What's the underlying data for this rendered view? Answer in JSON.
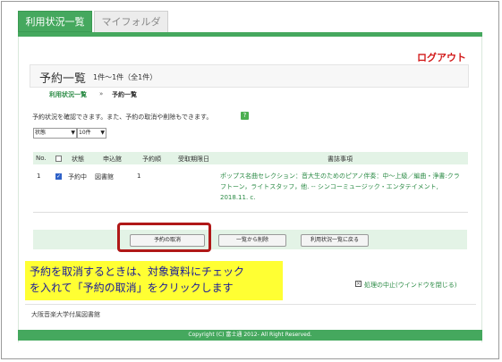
{
  "tabs": {
    "active": "利用状況一覧",
    "inactive": "マイフォルダ"
  },
  "logout": "ログアウト",
  "header": {
    "title": "予約一覧",
    "count": "1件～1件（全1件）"
  },
  "breadcrumb": {
    "link": "利用状況一覧",
    "separator": "»",
    "current": "予約一覧"
  },
  "description": "予約状況を確認できます。また、予約の取消や削除もできます。",
  "help_icon_label": "?",
  "selects": {
    "status": "状態",
    "per_page": "10件"
  },
  "table": {
    "headers": {
      "no": "No.",
      "status": "状態",
      "library": "申込館",
      "order": "予約順",
      "deadline": "受取期限日",
      "item": "書誌事項"
    },
    "rows": [
      {
        "no": "1",
        "checked": true,
        "status": "予約中",
        "library": "図書館",
        "order": "1",
        "deadline": "",
        "item": "ポップス名曲セレクション：音大生のためのピアノ伴奏：中～上級／編曲・浄書:クラフトーン，ライトスタッフ，他. -- シンコーミュージック・エンタテイメント, 2018.11. c."
      }
    ]
  },
  "buttons": {
    "cancel": "予約の取消",
    "delete": "一覧から削除",
    "back": "利用状況一覧に戻る"
  },
  "callout": {
    "line1": "予約を取消するときは、対象資料にチェック",
    "line2": "を入れて「予約の取消」をクリックします"
  },
  "stop_link": "処理の中止(ウインドウを閉じる)",
  "library_name": "大阪音楽大学付属図書館",
  "copyright": "Copyright (C) 富士通 2012- All Right Reserved.",
  "colors": {
    "accent_green": "#45a85e",
    "logout_red": "#d21a1a",
    "highlight_frame": "#b01818",
    "callout_yellow": "#ffff33",
    "callout_text": "#1a1a99",
    "link_green": "#2a8a44"
  }
}
